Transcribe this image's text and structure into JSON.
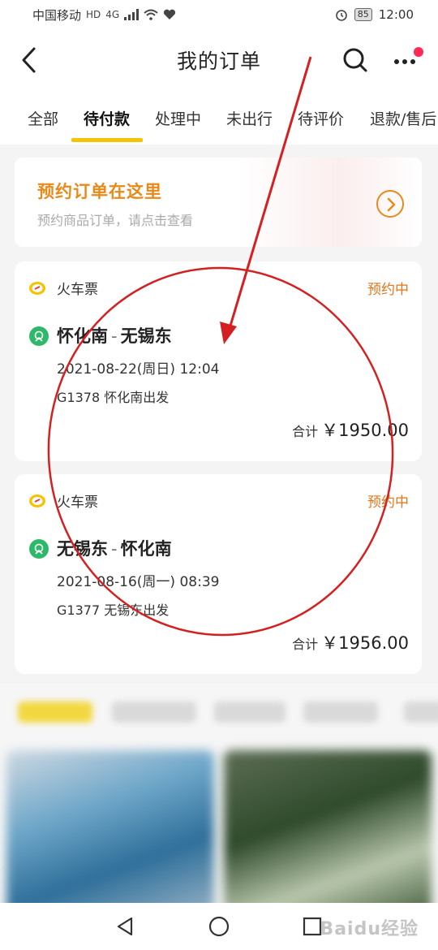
{
  "status_bar": {
    "carrier": "中国移动",
    "network_badges": [
      "HD",
      "4G"
    ],
    "battery": "85",
    "time": "12:00"
  },
  "nav": {
    "title": "我的订单"
  },
  "tabs": [
    {
      "label": "全部",
      "active": false
    },
    {
      "label": "待付款",
      "active": true
    },
    {
      "label": "处理中",
      "active": false
    },
    {
      "label": "未出行",
      "active": false
    },
    {
      "label": "待评价",
      "active": false
    },
    {
      "label": "退款/售后",
      "active": false
    }
  ],
  "promo": {
    "title": "预约订单在这里",
    "subtitle": "预约商品订单，请点击查看"
  },
  "orders": [
    {
      "category": "火车票",
      "status": "预约中",
      "from": "怀化南",
      "to": "无锡东",
      "datetime": "2021-08-22(周日) 12:04",
      "train": "G1378 怀化南出发",
      "total_label": "合计",
      "total_amount": "￥1950.00"
    },
    {
      "category": "火车票",
      "status": "预约中",
      "from": "无锡东",
      "to": "怀化南",
      "datetime": "2021-08-16(周一) 08:39",
      "train": "G1377 无锡东出发",
      "total_label": "合计",
      "total_amount": "￥1956.00"
    }
  ],
  "watermark": "Baidu经验",
  "colors": {
    "accent_orange": "#e88a1a",
    "status_orange": "#e2761b",
    "tab_underline": "#f5c400",
    "station_green": "#2eb869",
    "annotation_red": "#d42020"
  }
}
